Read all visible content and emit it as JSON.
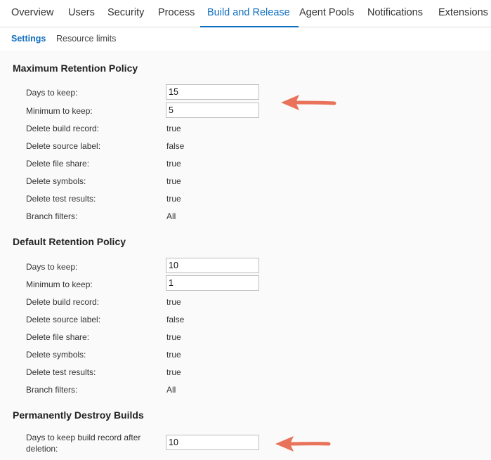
{
  "top_tabs": [
    "Overview",
    "Users",
    "Security",
    "Process",
    "Build and Release",
    "Agent Pools",
    "Notifications",
    "Extensions"
  ],
  "sub_tabs": [
    "Settings",
    "Resource limits"
  ],
  "maximum_policy": {
    "title": "Maximum Retention Policy",
    "days_label": "Days to keep:",
    "days_value": "15",
    "min_label": "Minimum to keep:",
    "min_value": "5",
    "rows": [
      {
        "label": "Delete build record:",
        "value": "true"
      },
      {
        "label": "Delete source label:",
        "value": "false"
      },
      {
        "label": "Delete file share:",
        "value": "true"
      },
      {
        "label": "Delete symbols:",
        "value": "true"
      },
      {
        "label": "Delete test results:",
        "value": "true"
      },
      {
        "label": "Branch filters:",
        "value": "All"
      }
    ]
  },
  "default_policy": {
    "title": "Default Retention Policy",
    "days_label": "Days to keep:",
    "days_value": "10",
    "min_label": "Minimum to keep:",
    "min_value": "1",
    "rows": [
      {
        "label": "Delete build record:",
        "value": "true"
      },
      {
        "label": "Delete source label:",
        "value": "false"
      },
      {
        "label": "Delete file share:",
        "value": "true"
      },
      {
        "label": "Delete symbols:",
        "value": "true"
      },
      {
        "label": "Delete test results:",
        "value": "true"
      },
      {
        "label": "Branch filters:",
        "value": "All"
      }
    ]
  },
  "destroy": {
    "title": "Permanently Destroy Builds",
    "label_line1": "Days to keep build record after",
    "label_line2": "deletion:",
    "value": "10"
  },
  "colors": {
    "accent": "#106ebe",
    "annotation_arrow": "#e8735a"
  }
}
